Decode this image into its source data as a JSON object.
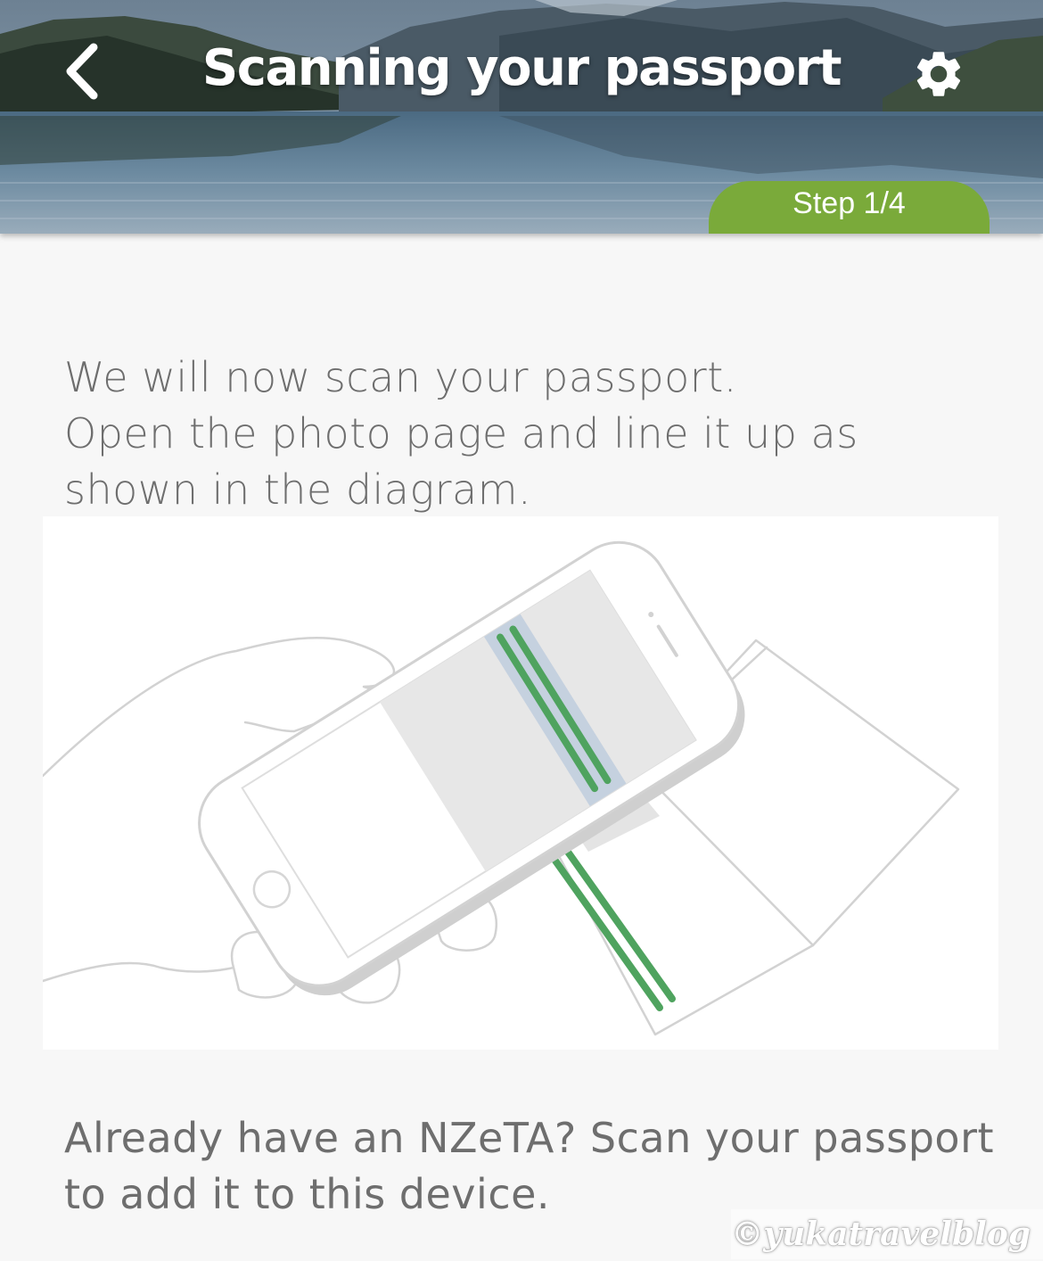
{
  "header": {
    "title": "Scanning your passport",
    "step_label": "Step 1/4",
    "back_icon": "chevron-left-icon",
    "settings_icon": "gear-icon"
  },
  "intro": {
    "lines": [
      "We will now scan your passport.",
      "Open the photo page and line it up as",
      "shown in the diagram."
    ]
  },
  "footer": {
    "lines": [
      "Already have an NZeTA? Scan your passport",
      "to add it to this device."
    ]
  },
  "watermark": "©yukatravelblog",
  "colors": {
    "accent_green": "#7aaa3a",
    "scan_line_green": "#4fa35f",
    "scan_band": "#c5d1df",
    "text_gray": "#6e6e6e",
    "background": "#f7f7f7"
  }
}
